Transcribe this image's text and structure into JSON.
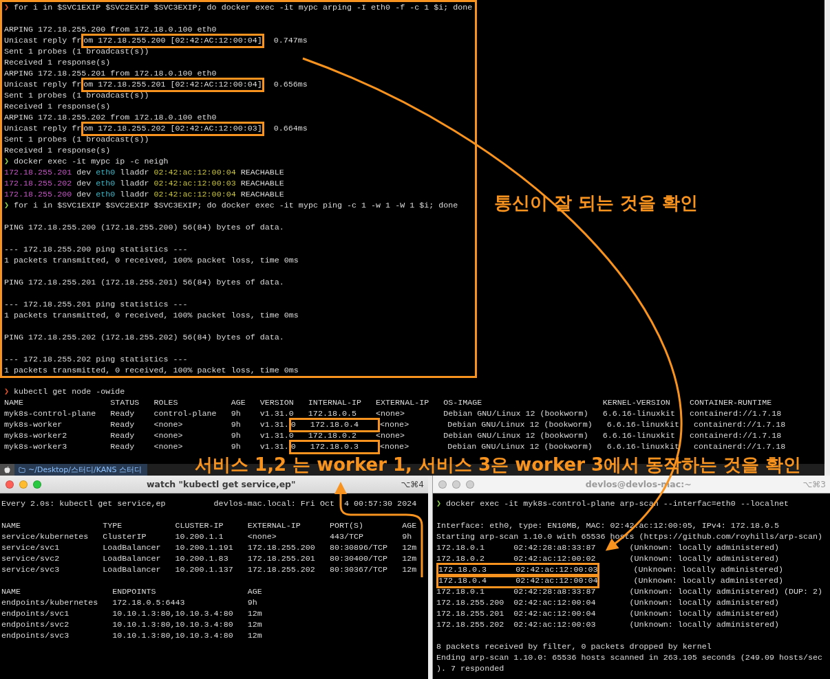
{
  "main_terminal": {
    "highlighted_blocks": [
      [
        [
          {
            "kind": "prompt",
            "text": "❯",
            "color": "#e8532a"
          },
          " for i in $SVC1EXIP $SVC2EXIP $SVC3EXIP; do docker exec -it mypc arping -I eth0 -f -c 1 $i; done"
        ]
      ],
      [
        "ARPING 172.18.255.200 from 172.18.0.100 eth0",
        [
          "Unicast reply fr",
          {
            "kind": "boxed",
            "text": "om 172.18.255.200 [02:42:AC:12:00:04]"
          },
          "  0.747ms"
        ],
        "Sent 1 probes (1 broadcast(s))",
        "Received 1 response(s)",
        "ARPING 172.18.255.201 from 172.18.0.100 eth0",
        [
          "Unicast reply fr",
          {
            "kind": "boxed",
            "text": "om 172.18.255.201 [02:42:AC:12:00:04]"
          },
          "  0.656ms"
        ],
        "Sent 1 probes (1 broadcast(s))",
        "Received 1 response(s)",
        "ARPING 172.18.255.202 from 172.18.0.100 eth0",
        [
          "Unicast reply fr",
          {
            "kind": "boxed",
            "text": "om 172.18.255.202 [02:42:AC:12:00:03]"
          },
          "  0.664ms"
        ],
        "Sent 1 probes (1 broadcast(s))",
        "Received 1 response(s)",
        [
          {
            "kind": "prompt",
            "text": "❯",
            "color": "#8fd14f"
          },
          " docker exec -it mypc ip -c neigh"
        ],
        [
          {
            "kind": "colored",
            "text": "172.18.255.201",
            "color": "#c653c6"
          },
          " dev ",
          {
            "kind": "colored",
            "text": "eth0",
            "color": "#3cb9c9"
          },
          " lladdr ",
          {
            "kind": "colored",
            "text": "02:42:ac:12:00:04",
            "color": "#c9c43a"
          },
          " REACHABLE"
        ],
        [
          {
            "kind": "colored",
            "text": "172.18.255.202",
            "color": "#c653c6"
          },
          " dev ",
          {
            "kind": "colored",
            "text": "eth0",
            "color": "#3cb9c9"
          },
          " lladdr ",
          {
            "kind": "colored",
            "text": "02:42:ac:12:00:03",
            "color": "#c9c43a"
          },
          " REACHABLE"
        ],
        [
          {
            "kind": "colored",
            "text": "172.18.255.200",
            "color": "#c653c6"
          },
          " dev ",
          {
            "kind": "colored",
            "text": "eth0",
            "color": "#3cb9c9"
          },
          " lladdr ",
          {
            "kind": "colored",
            "text": "02:42:ac:12:00:04",
            "color": "#c9c43a"
          },
          " REACHABLE"
        ],
        [
          {
            "kind": "prompt",
            "text": "❯",
            "color": "#8fd14f"
          },
          " for i in $SVC1EXIP $SVC2EXIP $SVC3EXIP; do docker exec -it mypc ping -c 1 -w 1 -W 1 $i; done"
        ]
      ],
      [
        "PING 172.18.255.200 (172.18.255.200) 56(84) bytes of data."
      ],
      [
        "--- 172.18.255.200 ping statistics ---",
        "1 packets transmitted, 0 received, 100% packet loss, time 0ms"
      ],
      [
        "PING 172.18.255.201 (172.18.255.201) 56(84) bytes of data."
      ],
      [
        "--- 172.18.255.201 ping statistics ---",
        "1 packets transmitted, 0 received, 100% packet loss, time 0ms"
      ],
      [
        "PING 172.18.255.202 (172.18.255.202) 56(84) bytes of data."
      ],
      [
        "--- 172.18.255.202 ping statistics ---",
        "1 packets transmitted, 0 received, 100% packet loss, time 0ms"
      ]
    ],
    "blocks": [
      [
        [
          {
            "kind": "prompt",
            "text": "❯",
            "color": "#e8532a"
          },
          " kubectl get node -owide"
        ],
        "NAME                  STATUS   ROLES           AGE   VERSION   INTERNAL-IP   EXTERNAL-IP   OS-IMAGE                         KERNEL-VERSION    CONTAINER-RUNTIME",
        "myk8s-control-plane   Ready    control-plane   9h    v1.31.0   172.18.0.5    <none>        Debian GNU/Linux 12 (bookworm)   6.6.16-linuxkit   containerd://1.7.18",
        [
          "myk8s-worker          Ready    <none>          9h    v1.31.",
          {
            "kind": "boxed",
            "text": "0   172.18.0.4    "
          },
          "<none>        Debian GNU/Linux 12 (bookworm)   6.6.16-linuxkit   containerd://1.7.18"
        ],
        "myk8s-worker2         Ready    <none>          9h    v1.31.0   172.18.0.2    <none>        Debian GNU/Linux 12 (bookworm)   6.6.16-linuxkit   containerd://1.7.18",
        [
          "myk8s-worker3         Ready    <none>          9h    v1.31.",
          {
            "kind": "boxed",
            "text": "0   172.18.0.3    "
          },
          "<none>        Debian GNU/Linux 12 (bookworm)   6.6.16-linuxkit   containerd://1.7.18"
        ]
      ]
    ],
    "status_bar": {
      "path": "~/Desktop/스터디/KANS 스터디"
    }
  },
  "windows": [
    {
      "title": "watch \"kubectl get service,ep\"",
      "shortcut": "⌥⌘4",
      "active": true,
      "blocks": [
        [
          "Every 2.0s: kubectl get service,ep          devlos-mac.local: Fri Oct  4 00:57:30 2024"
        ],
        [
          "NAME                 TYPE           CLUSTER-IP     EXTERNAL-IP      PORT(S)        AGE",
          "service/kubernetes   ClusterIP      10.200.1.1     <none>           443/TCP        9h",
          "service/svc1         LoadBalancer   10.200.1.191   172.18.255.200   80:30896/TCP   12m",
          "service/svc2         LoadBalancer   10.200.1.83    172.18.255.201   80:30400/TCP   12m",
          "service/svc3         LoadBalancer   10.200.1.137   172.18.255.202   80:30367/TCP   12m"
        ],
        [
          "NAME                   ENDPOINTS                   AGE",
          "endpoints/kubernetes   172.18.0.5:6443             9h",
          "endpoints/svc1         10.10.1.3:80,10.10.3.4:80   12m",
          "endpoints/svc2         10.10.1.3:80,10.10.3.4:80   12m",
          "endpoints/svc3         10.10.1.3:80,10.10.3.4:80   12m"
        ]
      ]
    },
    {
      "title": "devlos@devlos-mac:~",
      "shortcut": "⌥⌘3",
      "active": false,
      "blocks": [
        [
          [
            {
              "kind": "prompt",
              "text": "❯",
              "color": "#8fd14f"
            },
            " docker exec -it myk8s-control-plane arp-scan --interfac=eth0 --localnet"
          ]
        ],
        [
          "Interface: eth0, type: EN10MB, MAC: 02:42:ac:12:00:05, IPv4: 172.18.0.5",
          "Starting arp-scan 1.10.0 with 65536 hosts (https://github.com/royhills/arp-scan)",
          "172.18.0.1      02:42:28:a8:33:87       (Unknown: locally administered)",
          "172.18.0.2      02:42:ac:12:00:02       (Unknown: locally administered)",
          [
            {
              "kind": "boxed",
              "text": "172.18.0.3      02:42:ac:12:00:03"
            },
            "       (Unknown: locally administered)"
          ],
          [
            {
              "kind": "boxed",
              "text": "172.18.0.4      02:42:ac:12:00:04"
            },
            "       (Unknown: locally administered)"
          ],
          "172.18.0.1      02:42:28:a8:33:87       (Unknown: locally administered) (DUP: 2)",
          "172.18.255.200  02:42:ac:12:00:04       (Unknown: locally administered)",
          "172.18.255.201  02:42:ac:12:00:04       (Unknown: locally administered)",
          "172.18.255.202  02:42:ac:12:00:03       (Unknown: locally administered)"
        ],
        [
          "8 packets received by filter, 0 packets dropped by kernel",
          "Ending arp-scan 1.10.0: 65536 hosts scanned in 263.105 seconds (249.09 hosts/sec",
          "). 7 responded"
        ]
      ]
    }
  ],
  "annotations": [
    {
      "kind": "note",
      "text": "통신이 잘 되는 것을 확인"
    },
    {
      "kind": "caption",
      "text": "서비스 1,2 는 worker 1, 서비스 3은 worker 3에서 동작하는 것을 확인"
    }
  ]
}
